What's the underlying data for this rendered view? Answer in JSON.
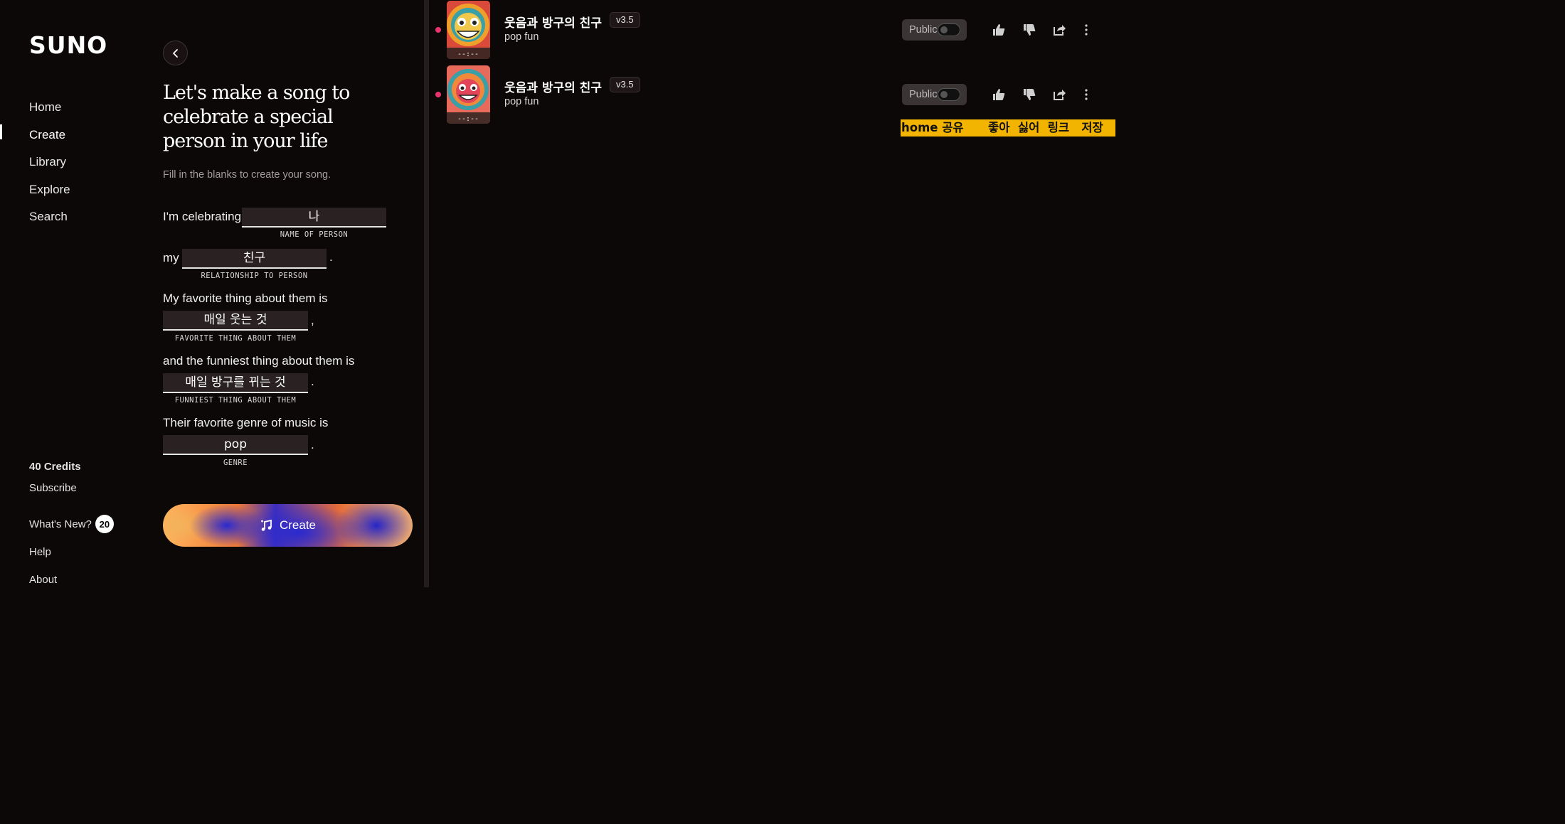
{
  "sidebar": {
    "logo": "SUNO",
    "nav": [
      "Home",
      "Create",
      "Library",
      "Explore",
      "Search"
    ],
    "active": "Create",
    "credits": "40 Credits",
    "subscribe": "Subscribe",
    "whats_new": "What's New?",
    "whats_new_count": "20",
    "help": "Help",
    "about": "About"
  },
  "create": {
    "headline": "Let's make a song to celebrate a special person in your life",
    "subline": "Fill in the blanks to create your song.",
    "prompt1": "I'm celebrating",
    "name_value": "나",
    "name_label": "NAME OF PERSON",
    "prompt2": "my",
    "relationship_value": "친구",
    "relationship_label": "RELATIONSHIP TO PERSON",
    "prompt3": "My favorite thing about them is",
    "favorite_value": "매일 웃는 것",
    "favorite_label": "FAVORITE THING ABOUT THEM",
    "prompt4": "and the funniest thing about them is",
    "funniest_value": "매일 방구를 뀌는 것",
    "funniest_label": "FUNNIEST THING ABOUT THEM",
    "prompt5": "Their favorite genre of music is",
    "genre_value": "pop",
    "genre_label": "GENRE",
    "create_label": "Create"
  },
  "songs": [
    {
      "title": "웃음과 방구의 친구",
      "version": "v3.5",
      "style": "pop fun",
      "visibility": "Public"
    },
    {
      "title": "웃음과 방구의 친구",
      "version": "v3.5",
      "style": "pop fun",
      "visibility": "Public"
    }
  ],
  "overlay_text": "home 공유      좋아  싫어  링크   저장",
  "colors": {
    "accent_dot": "#e8336f",
    "overlay_bg": "#f2b400"
  }
}
